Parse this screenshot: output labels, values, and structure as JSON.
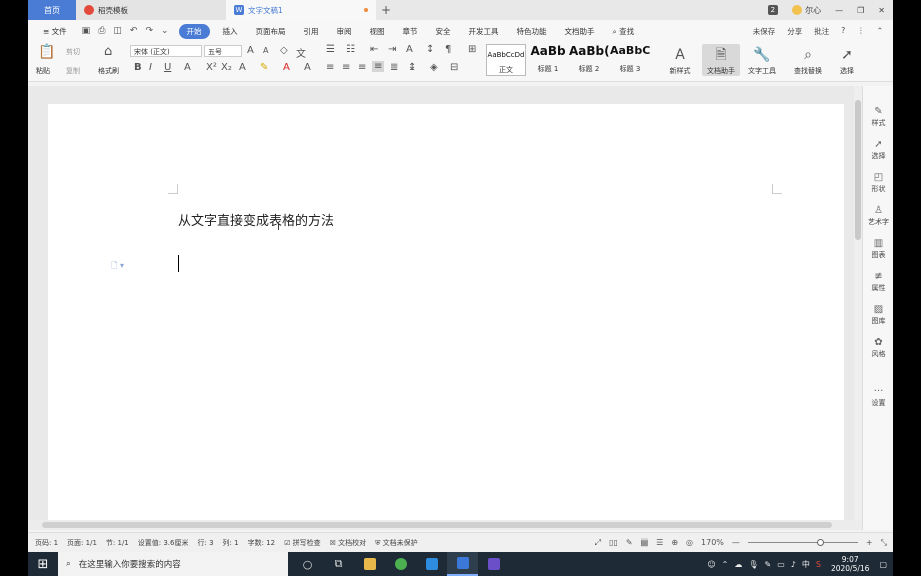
{
  "titlebar": {
    "home_tab": "首页",
    "tab1": "稻壳模板",
    "tab2": "文字文稿1",
    "add_tab": "+",
    "badge": "2",
    "user": "尔心",
    "win_min": "—",
    "win_restore": "❐",
    "win_close": "✕"
  },
  "menu": {
    "file": "≡ 文件",
    "items": [
      "开始",
      "插入",
      "页面布局",
      "引用",
      "审阅",
      "视图",
      "章节",
      "安全",
      "开发工具",
      "特色功能",
      "文档助手"
    ],
    "search": "查找",
    "unsaved": "未保存",
    "share": "分享",
    "comment": "批注",
    "help": "?",
    "more": "⋮",
    "collapse": "⌃"
  },
  "ribbon": {
    "paste": "粘贴",
    "cut": "剪切",
    "copy": "复制",
    "format_painter": "格式刷",
    "font_name": "宋体 (正文)",
    "font_size": "五号",
    "styles": [
      {
        "preview": "AaBbCcDd",
        "label": "正文"
      },
      {
        "preview": "AaBb",
        "label": "标题 1"
      },
      {
        "preview": "AaBb(",
        "label": "标题 2"
      },
      {
        "preview": "AaBbC",
        "label": "标题 3"
      }
    ],
    "new_style": "新样式",
    "doc_helper": "文档助手",
    "text_tools": "文字工具",
    "find_replace": "查找替换",
    "select": "选择"
  },
  "document": {
    "text": "从文字直接变成表格的方法"
  },
  "right_panel": [
    "样式",
    "选择",
    "形状",
    "艺术字",
    "图表",
    "属性",
    "图库",
    "风格",
    "设置"
  ],
  "statusbar": {
    "items": [
      "页码: 1",
      "页面: 1/1",
      "节: 1/1",
      "设置值: 3.6厘米",
      "行: 3",
      "列: 1",
      "字数: 12",
      "拼写检查",
      "文档校对",
      "文档未保护"
    ],
    "zoom": "170%",
    "zoom_level": 0.63
  },
  "taskbar": {
    "search_placeholder": "在这里输入你要搜索的内容",
    "time": "9:07",
    "date": "2020/5/16",
    "ime": "中"
  }
}
